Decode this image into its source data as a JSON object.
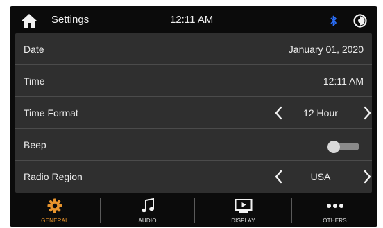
{
  "statusbar": {
    "title": "Settings",
    "clock": "12:11 AM",
    "home_icon": "home-icon",
    "bluetooth_icon": "bluetooth-icon",
    "brightness_icon": "brightness-icon",
    "bluetooth_color": "#2a6df4"
  },
  "settings": {
    "date": {
      "label": "Date",
      "value": "January 01, 2020"
    },
    "time": {
      "label": "Time",
      "value": "12:11 AM"
    },
    "time_format": {
      "label": "Time Format",
      "value": "12 Hour"
    },
    "beep": {
      "label": "Beep",
      "state": "off"
    },
    "radio_region": {
      "label": "Radio Region",
      "value": "USA"
    }
  },
  "nav": {
    "general": {
      "label": "GENERAL",
      "icon": "gear-icon",
      "active": true
    },
    "audio": {
      "label": "AUDIO",
      "icon": "music-note-icon"
    },
    "display": {
      "label": "DISPLAY",
      "icon": "display-icon"
    },
    "others": {
      "label": "OTHERS",
      "icon": "more-dots-icon"
    }
  },
  "colors": {
    "accent": "#e8942d",
    "panel": "#2f2f2f",
    "background": "#0b0b0b"
  }
}
